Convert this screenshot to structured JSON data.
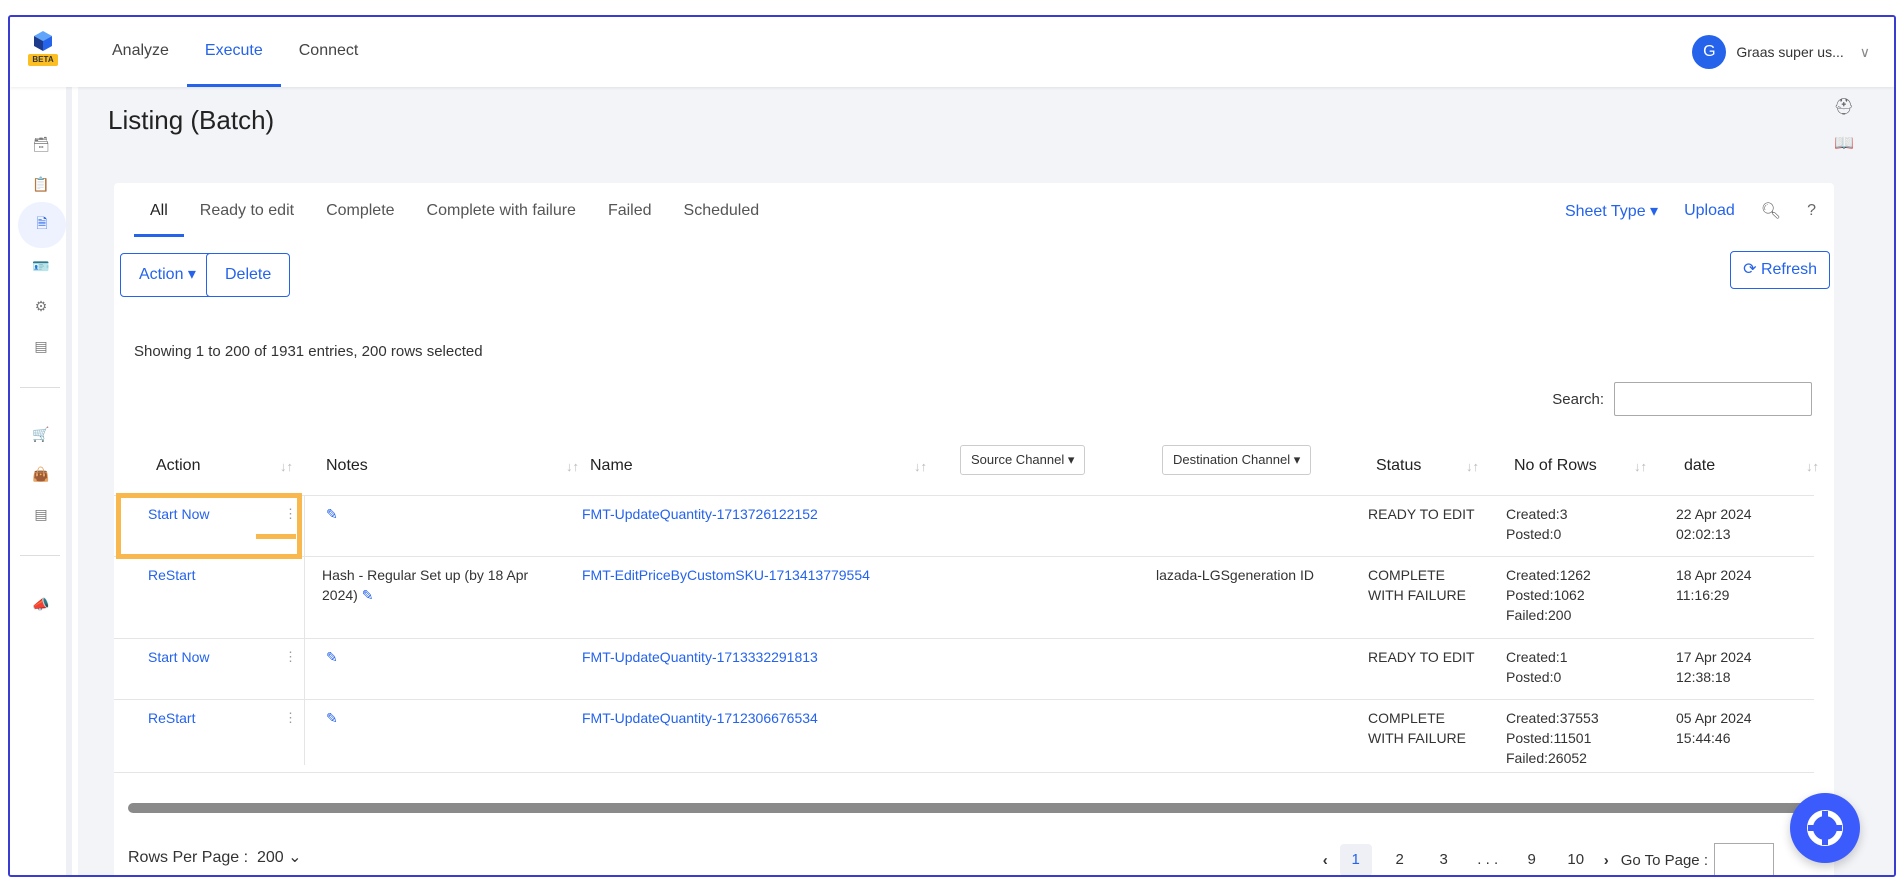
{
  "app": {
    "beta": "BETA"
  },
  "topnav": {
    "items": [
      {
        "label": "Analyze"
      },
      {
        "label": "Execute"
      },
      {
        "label": "Connect"
      }
    ]
  },
  "user": {
    "initial": "G",
    "name": "Graas super us..."
  },
  "page": {
    "title": "Listing (Batch)"
  },
  "tabs": [
    {
      "label": "All"
    },
    {
      "label": "Ready to edit"
    },
    {
      "label": "Complete"
    },
    {
      "label": "Complete with failure"
    },
    {
      "label": "Failed"
    },
    {
      "label": "Scheduled"
    }
  ],
  "tools": {
    "sheet_type": "Sheet Type ▾",
    "upload": "Upload",
    "help": "?"
  },
  "buttons": {
    "action": "Action ▾",
    "delete": "Delete",
    "refresh": "Refresh"
  },
  "info": "Showing 1 to 200 of 1931 entries, 200 rows selected",
  "search": {
    "label": "Search:"
  },
  "columns": {
    "action": "Action",
    "notes": "Notes",
    "name": "Name",
    "source": "Source Channel ▾",
    "destination": "Destination Channel ▾",
    "status": "Status",
    "rows": "No of Rows",
    "date": "date"
  },
  "rows": [
    {
      "action": "Start Now",
      "notes": "",
      "name": "FMT-UpdateQuantity-1713726122152",
      "destination": "",
      "status1": "READY TO EDIT",
      "status2": "",
      "r1": "Created:3",
      "r2": "Posted:0",
      "r3": "",
      "d1": "22 Apr 2024",
      "d2": "02:02:13"
    },
    {
      "action": "ReStart",
      "notes": "Hash - Regular Set up (by 18 Apr",
      "notes2": "2024)",
      "name": "FMT-EditPriceByCustomSKU-1713413779554",
      "destination": "lazada-LGSgeneration ID",
      "status1": "COMPLETE",
      "status2": "WITH FAILURE",
      "r1": "Created:1262",
      "r2": "Posted:1062",
      "r3": "Failed:200",
      "d1": "18 Apr 2024",
      "d2": "11:16:29"
    },
    {
      "action": "Start Now",
      "notes": "",
      "name": "FMT-UpdateQuantity-1713332291813",
      "destination": "",
      "status1": "READY TO EDIT",
      "status2": "",
      "r1": "Created:1",
      "r2": "Posted:0",
      "r3": "",
      "d1": "17 Apr 2024",
      "d2": "12:38:18"
    },
    {
      "action": "ReStart",
      "notes": "",
      "name": "FMT-UpdateQuantity-1712306676534",
      "destination": "",
      "status1": "COMPLETE",
      "status2": "WITH FAILURE",
      "r1": "Created:37553",
      "r2": "Posted:11501",
      "r3": "Failed:26052",
      "d1": "05 Apr 2024",
      "d2": "15:44:46"
    }
  ],
  "footer": {
    "rows_per_page_label": "Rows Per Page :",
    "rows_per_page": "200",
    "pages": [
      "1",
      "2",
      "3",
      ". . .",
      "9",
      "10"
    ],
    "goto": "Go To Page :"
  },
  "colors": {
    "accent": "#2563eb",
    "highlight": "#f8b84e",
    "fab": "#3b5bfd"
  }
}
